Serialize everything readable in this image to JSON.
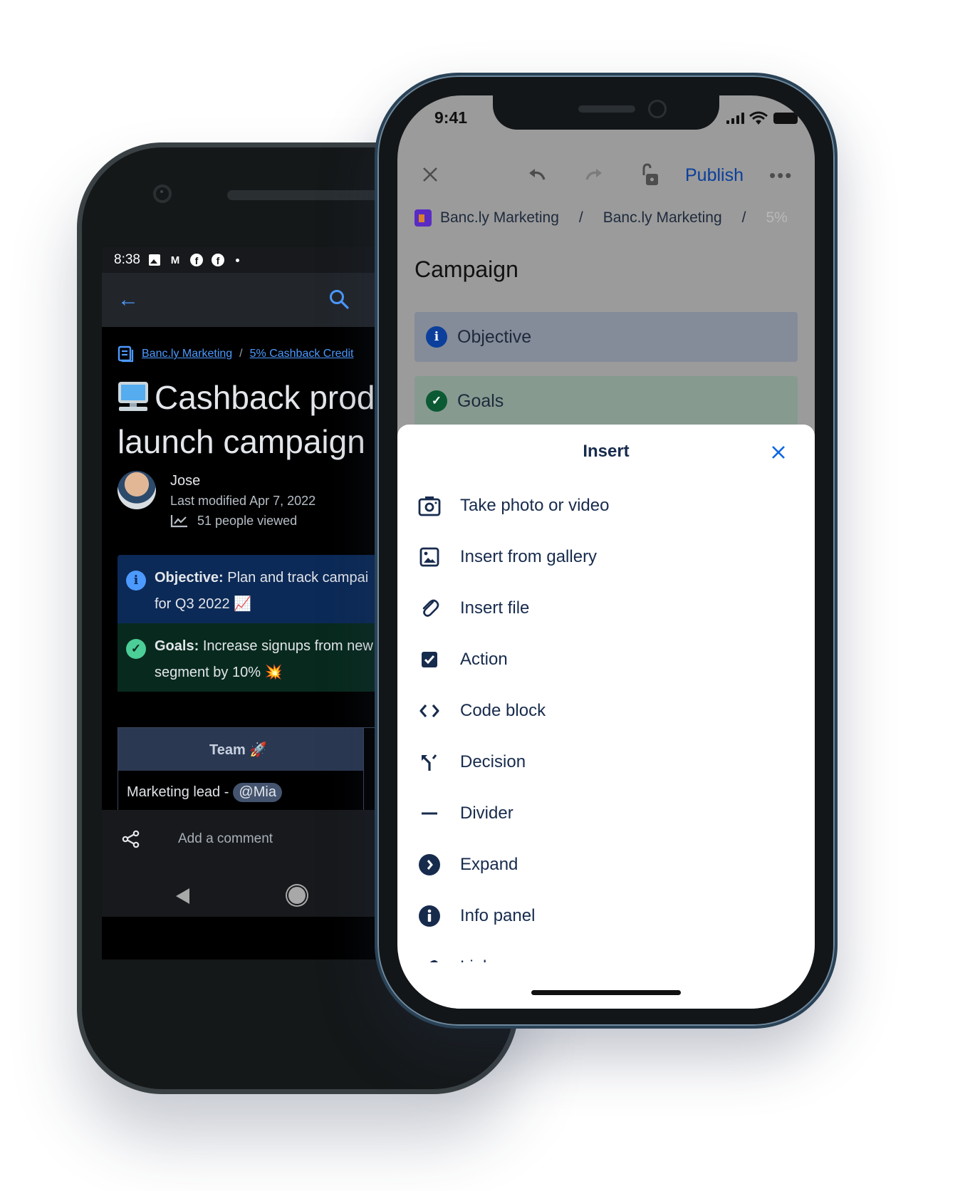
{
  "android": {
    "status_bar": {
      "time": "8:38",
      "icons": [
        "image-icon",
        "gmail-icon",
        "facebook-icon",
        "facebook-icon",
        "dot-icon"
      ]
    },
    "app_bar": {
      "back_icon": "arrow-left-icon",
      "search_icon": "search-icon"
    },
    "breadcrumb": {
      "icon": "page-icon",
      "items": [
        "Banc.ly Marketing",
        "5% Cashback Credit"
      ],
      "separator": "/"
    },
    "page": {
      "title_emoji": "desktop-computer",
      "title": "Cashback product launch campaign",
      "title_line1": "Cashback produ",
      "title_line2": "launch campaign",
      "author": "Jose",
      "last_modified": "Last modified Apr 7, 2022",
      "views": "51 people viewed"
    },
    "panels": [
      {
        "type": "info",
        "label": "Objective:",
        "line1": "Plan and track campai",
        "line2": "for Q3 2022 📈"
      },
      {
        "type": "success",
        "label": "Goals:",
        "line1": "Increase signups from new",
        "line2": "segment by 10% 💥"
      }
    ],
    "table": {
      "header": "Team 🚀",
      "rows": [
        {
          "text": "Marketing lead -",
          "mention": "@Mia"
        }
      ]
    },
    "comment_bar": {
      "share_icon": "share-icon",
      "placeholder": "Add a comment"
    },
    "nav_bar": {
      "back": "nav-back-icon",
      "home": "nav-home-icon"
    }
  },
  "iphone": {
    "status_bar": {
      "time": "9:41"
    },
    "toolbar": {
      "close": "close-icon",
      "undo": "undo-icon",
      "redo": "redo-icon",
      "lock": "unlock-icon",
      "publish": "Publish",
      "more": "•••"
    },
    "breadcrumb": {
      "items": [
        "Banc.ly Marketing",
        "Banc.ly Marketing",
        "5%"
      ],
      "separator": "/"
    },
    "page_title": "Campaign",
    "panels": [
      {
        "type": "info",
        "label": "Objective"
      },
      {
        "type": "success",
        "label": "Goals"
      }
    ],
    "insert_sheet": {
      "title": "Insert",
      "items": [
        {
          "label": "Take photo or video",
          "icon": "camera-icon"
        },
        {
          "label": "Insert from gallery",
          "icon": "gallery-icon"
        },
        {
          "label": "Insert file",
          "icon": "paperclip-icon"
        },
        {
          "label": "Action",
          "icon": "checkbox-icon"
        },
        {
          "label": "Code block",
          "icon": "code-icon"
        },
        {
          "label": "Decision",
          "icon": "decision-icon"
        },
        {
          "label": "Divider",
          "icon": "divider-icon"
        },
        {
          "label": "Expand",
          "icon": "expand-icon"
        },
        {
          "label": "Info panel",
          "icon": "info-icon"
        },
        {
          "label": "Link",
          "icon": "link-icon"
        }
      ]
    }
  },
  "colors": {
    "android_link": "#4c9aff",
    "android_info_panel": "#0c2a57",
    "android_success_panel": "#082a1e",
    "ios_publish": "#0b3f9b",
    "ios_text": "#172b4d",
    "ios_close_x": "#0c66e4"
  }
}
